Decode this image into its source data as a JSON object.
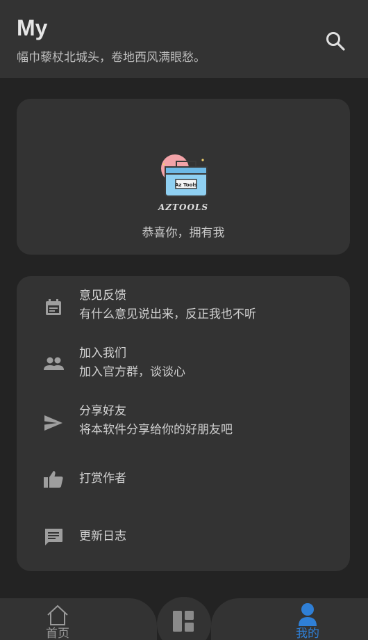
{
  "header": {
    "title": "My",
    "subtitle": "幅巾藜杖北城头，卷地西风满眼愁。",
    "search_icon": "search-icon"
  },
  "hero": {
    "logo_text": "AZTOOLS",
    "logo_box_text": "Az Tools",
    "congrats": "恭喜你，拥有我"
  },
  "menu": {
    "items": [
      {
        "icon": "calendar-icon",
        "title": "意见反馈",
        "subtitle": "有什么意见说出来，反正我也不听"
      },
      {
        "icon": "group-icon",
        "title": "加入我们",
        "subtitle": "加入官方群，谈谈心"
      },
      {
        "icon": "send-icon",
        "title": "分享好友",
        "subtitle": "将本软件分享给你的好朋友吧"
      },
      {
        "icon": "thumb-up-icon",
        "title": "打赏作者",
        "subtitle": ""
      },
      {
        "icon": "message-icon",
        "title": "更新日志",
        "subtitle": ""
      }
    ]
  },
  "nav": {
    "home_label": "首页",
    "mine_label": "我的",
    "active_color": "#2f7fd6",
    "inactive_color": "#9a9a9a"
  },
  "colors": {
    "background": "#232323",
    "card": "#333333",
    "icon": "#9e9e9e",
    "logo_pink": "#f3a3a8",
    "logo_blue": "#8fd0f2"
  }
}
